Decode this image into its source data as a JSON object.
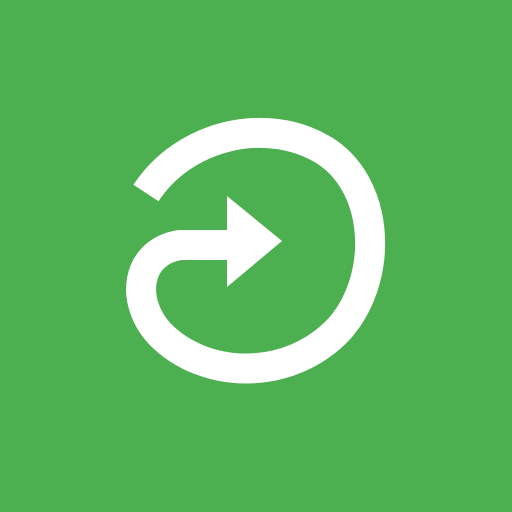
{
  "app_icon": {
    "icon_name": "circular-redo-arrow-icon",
    "colors": {
      "background": "#4caf50",
      "foreground": "#ffffff"
    }
  }
}
